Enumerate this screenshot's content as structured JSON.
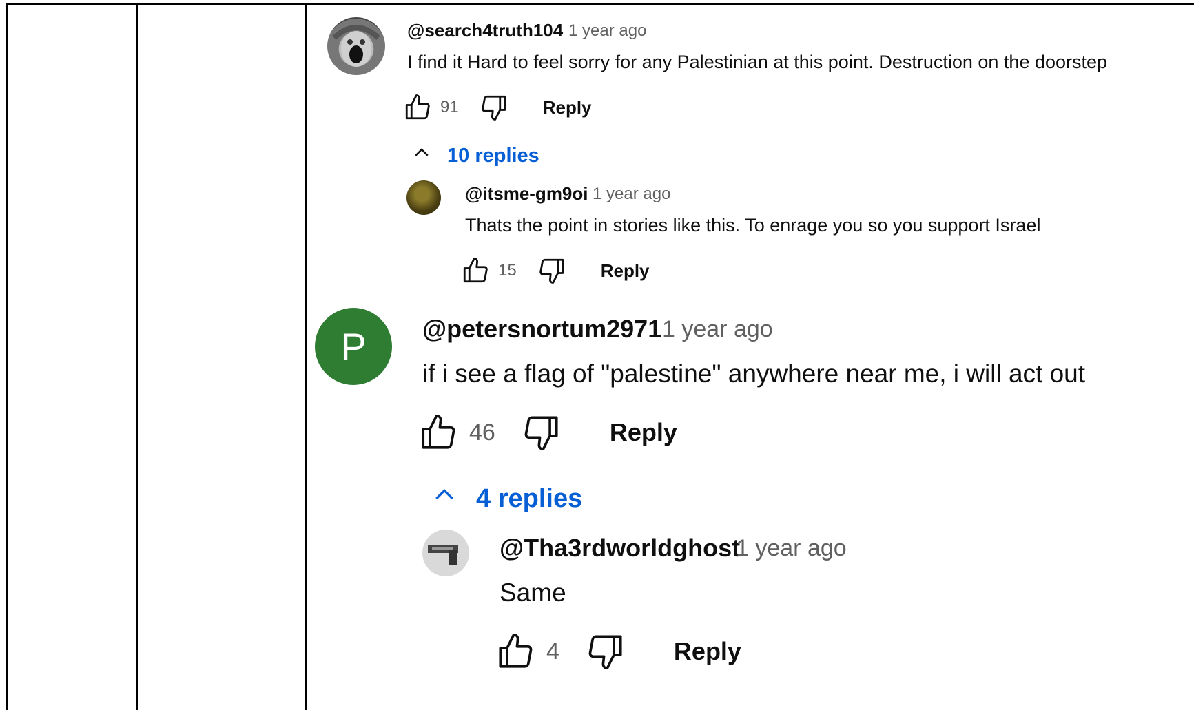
{
  "comments": [
    {
      "handle": "@search4truth104",
      "time": "1 year ago",
      "text": "I find it Hard to feel sorry for any Palestinian at this point. Destruction on the doorstep",
      "likes": "91",
      "reply_label": "Reply",
      "replies_toggle": "10 replies",
      "reply": {
        "handle": "@itsme-gm9oi",
        "time": "1 year ago",
        "text": "Thats the point in stories like this. To enrage you so you support Israel",
        "likes": "15",
        "reply_label": "Reply"
      }
    },
    {
      "avatar_letter": "P",
      "avatar_color": "#2e7d32",
      "handle": "@petersnortum2971",
      "time": "1 year ago",
      "text": "if i see a flag of \"palestine\" anywhere near me, i will act out",
      "likes": "46",
      "reply_label": "Reply",
      "replies_toggle": "4 replies",
      "reply": {
        "handle": "@Tha3rdworldghost",
        "time": "1 year ago",
        "text": "Same",
        "likes": "4",
        "reply_label": "Reply"
      }
    }
  ],
  "colors": {
    "link_blue": "#065fd4",
    "meta_gray": "#606060",
    "avatar_green": "#2e7d32"
  },
  "icons": [
    "like-icon",
    "dislike-icon",
    "chevron-up-icon"
  ]
}
